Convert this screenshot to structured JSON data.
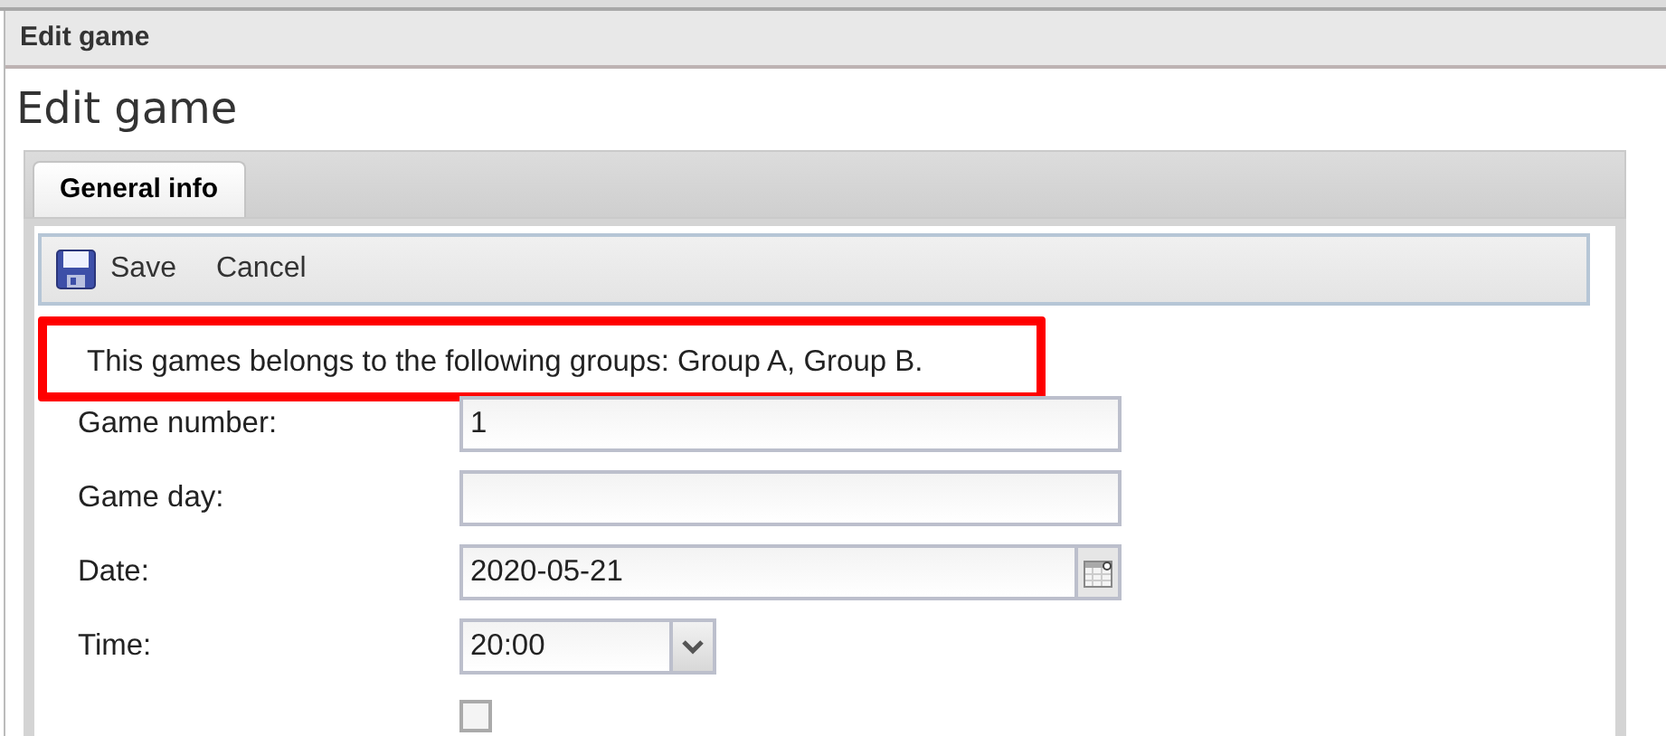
{
  "window": {
    "title": "Edit game"
  },
  "heading": "Edit game",
  "tabs": [
    {
      "label": "General info",
      "selected": true
    }
  ],
  "toolbar": {
    "buttons": [
      {
        "label": "Save",
        "kind": "save"
      },
      {
        "label": "Cancel",
        "kind": "plain"
      }
    ]
  },
  "notice": {
    "text": "This games belongs to the following groups: Group A, Group B.",
    "highlighted": true
  },
  "fields": [
    {
      "kind": "text",
      "label": "Game number:",
      "value": "1"
    },
    {
      "kind": "text",
      "label": "Game day:"
    },
    {
      "kind": "date",
      "label": "Date:",
      "value": "2020-05-21"
    },
    {
      "kind": "select",
      "label": "Time:",
      "value": "20:00"
    },
    {
      "kind": "checkbox",
      "checked": false
    }
  ]
}
